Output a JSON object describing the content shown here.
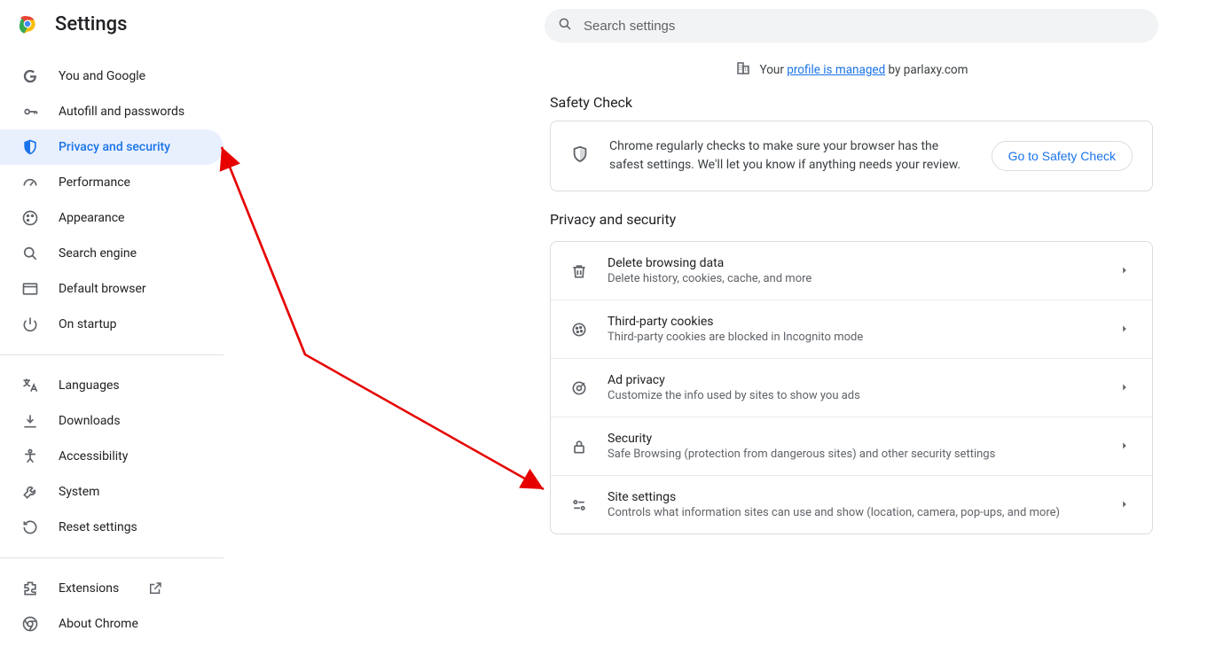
{
  "header": {
    "title": "Settings"
  },
  "search": {
    "placeholder": "Search settings"
  },
  "managed": {
    "prefix": "Your ",
    "link": "profile is managed",
    "suffix": " by parlaxy.com"
  },
  "sidebar": {
    "items": [
      {
        "label": "You and Google"
      },
      {
        "label": "Autofill and passwords"
      },
      {
        "label": "Privacy and security"
      },
      {
        "label": "Performance"
      },
      {
        "label": "Appearance"
      },
      {
        "label": "Search engine"
      },
      {
        "label": "Default browser"
      },
      {
        "label": "On startup"
      }
    ],
    "items2": [
      {
        "label": "Languages"
      },
      {
        "label": "Downloads"
      },
      {
        "label": "Accessibility"
      },
      {
        "label": "System"
      },
      {
        "label": "Reset settings"
      }
    ],
    "items3": [
      {
        "label": "Extensions"
      },
      {
        "label": "About Chrome"
      }
    ]
  },
  "safety": {
    "heading": "Safety Check",
    "message": "Chrome regularly checks to make sure your browser has the safest settings. We'll let you know if anything needs your review.",
    "button": "Go to Safety Check"
  },
  "privacy": {
    "heading": "Privacy and security",
    "rows": [
      {
        "title": "Delete browsing data",
        "sub": "Delete history, cookies, cache, and more"
      },
      {
        "title": "Third-party cookies",
        "sub": "Third-party cookies are blocked in Incognito mode"
      },
      {
        "title": "Ad privacy",
        "sub": "Customize the info used by sites to show you ads"
      },
      {
        "title": "Security",
        "sub": "Safe Browsing (protection from dangerous sites) and other security settings"
      },
      {
        "title": "Site settings",
        "sub": "Controls what information sites can use and show (location, camera, pop-ups, and more)"
      }
    ]
  }
}
